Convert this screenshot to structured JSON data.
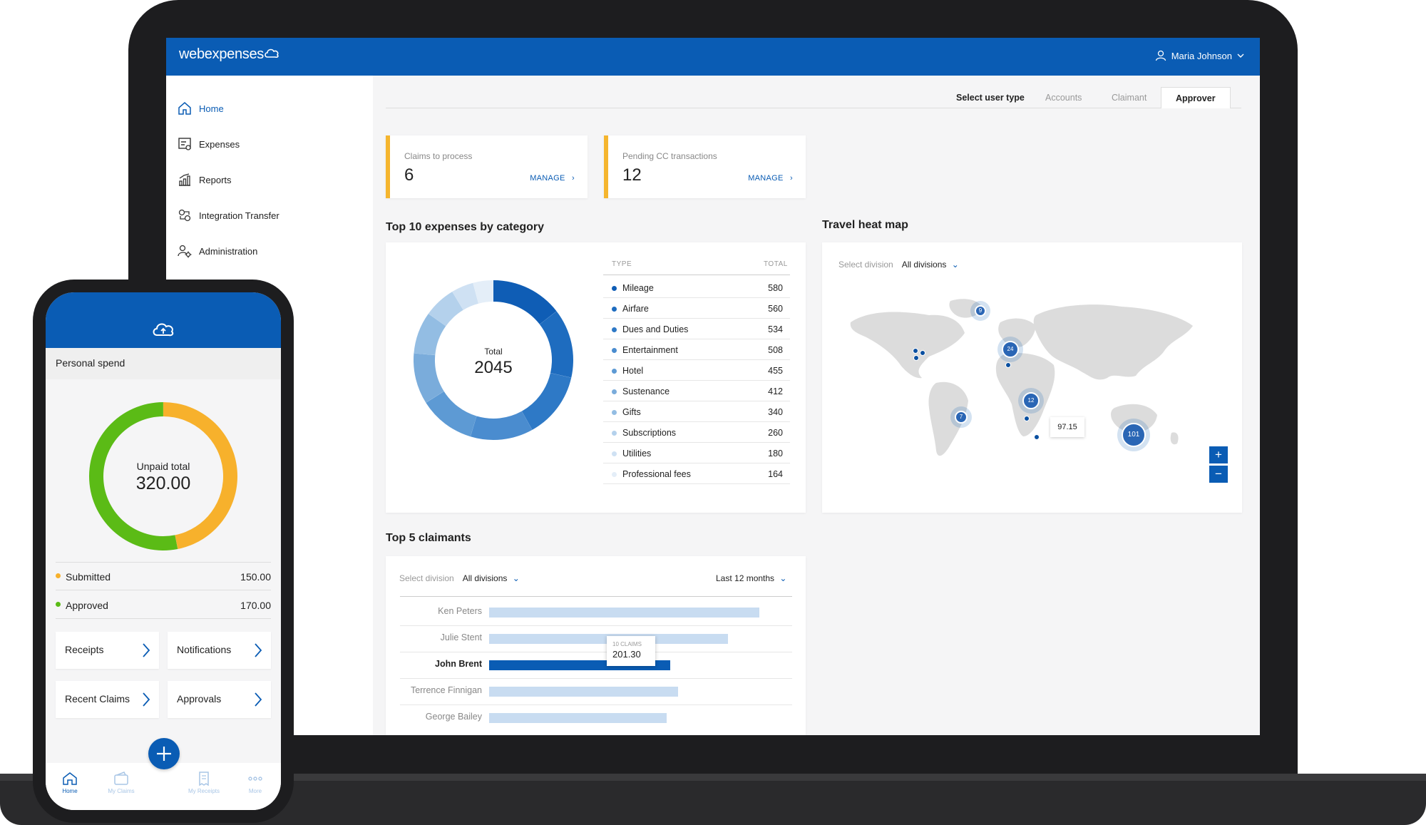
{
  "app": {
    "logo": "webexpenses",
    "user_name": "Maria Johnson"
  },
  "sidebar": {
    "items": [
      {
        "label": "Home",
        "icon": "home-icon"
      },
      {
        "label": "Expenses",
        "icon": "expenses-icon"
      },
      {
        "label": "Reports",
        "icon": "reports-icon"
      },
      {
        "label": "Integration Transfer",
        "icon": "integration-icon"
      },
      {
        "label": "Administration",
        "icon": "administration-icon"
      }
    ]
  },
  "user_type": {
    "label": "Select user type",
    "options": [
      "Accounts",
      "Claimant",
      "Approver"
    ],
    "selected": "Approver"
  },
  "stats": [
    {
      "label": "Claims to process",
      "value": "6",
      "link": "MANAGE"
    },
    {
      "label": "Pending CC transactions",
      "value": "12",
      "link": "MANAGE"
    }
  ],
  "expenses": {
    "title": "Top 10 expenses by category",
    "col_type": "TYPE",
    "col_total": "TOTAL",
    "total_label": "Total",
    "total_value": "2045"
  },
  "chart_data": [
    {
      "type": "pie",
      "title": "Top 10 expenses by category",
      "categories": [
        "Mileage",
        "Airfare",
        "Dues and Duties",
        "Entertainment",
        "Hotel",
        "Sustenance",
        "Gifts",
        "Subscriptions",
        "Utilities",
        "Professional fees"
      ],
      "values": [
        580,
        560,
        534,
        508,
        455,
        412,
        340,
        260,
        180,
        164
      ],
      "colors": [
        "#0f5db5",
        "#1e6cbf",
        "#2e79c6",
        "#4a8ccf",
        "#5d9ad4",
        "#7aacdb",
        "#93bde3",
        "#b4d1ec",
        "#cfe1f3",
        "#e4eef8"
      ]
    },
    {
      "type": "bar",
      "title": "Top 5 claimants",
      "categories": [
        "Ken Peters",
        "Julie Stent",
        "John Brent",
        "Terrence Finnigan",
        "George Bailey"
      ],
      "values": [
        300,
        265,
        201.3,
        210,
        197
      ],
      "highlight": "John Brent",
      "tooltip_label": "10 CLAIMS",
      "tooltip_value": "201.30"
    },
    {
      "type": "pie",
      "title": "Personal spend",
      "categories": [
        "Submitted",
        "Approved"
      ],
      "values": [
        150.0,
        170.0
      ],
      "colors": [
        "#f7b12c",
        "#5bbb16"
      ]
    }
  ],
  "heatmap": {
    "title": "Travel heat map",
    "select_label": "Select division",
    "select_value": "All divisions",
    "clusters": [
      "9",
      "24",
      "12",
      "7",
      "101"
    ],
    "callout": "97.15",
    "zoom_in": "+",
    "zoom_out": "−"
  },
  "claimants": {
    "title": "Top 5 claimants",
    "select_label": "Select division",
    "select_value": "All divisions",
    "period": "Last 12 months"
  },
  "phone": {
    "title": "Personal spend",
    "unpaid_label": "Unpaid total",
    "unpaid_value": "320.00",
    "lines": [
      {
        "label": "Submitted",
        "value": "150.00",
        "color": "#f7b12c"
      },
      {
        "label": "Approved",
        "value": "170.00",
        "color": "#5bbb16"
      }
    ],
    "tiles": [
      "Receipts",
      "Notifications",
      "Recent Claims",
      "Approvals"
    ],
    "tabs": [
      "Home",
      "My Claims",
      "My Receipts",
      "More"
    ]
  },
  "colors": {
    "brand": "#0a5cb4",
    "accent": "#f5b52e"
  }
}
